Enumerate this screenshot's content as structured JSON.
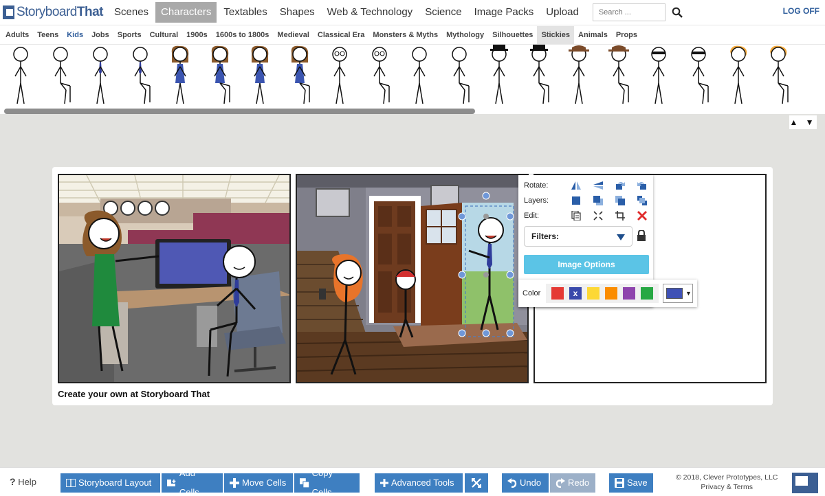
{
  "brand": {
    "name_light": "Storyboard",
    "name_bold": "That"
  },
  "topnav": {
    "items": [
      "Scenes",
      "Characters",
      "Textables",
      "Shapes",
      "Web & Technology",
      "Science",
      "Image Packs",
      "Upload"
    ],
    "active": "Characters",
    "search_placeholder": "Search ...",
    "logoff": "LOG OFF"
  },
  "categories": {
    "items": [
      "Adults",
      "Teens",
      "Kids",
      "Jobs",
      "Sports",
      "Cultural",
      "1900s",
      "1600s to 1800s",
      "Medieval",
      "Classical Era",
      "Monsters & Myths",
      "Mythology",
      "Silhouettes",
      "Stickies",
      "Animals",
      "Props"
    ],
    "selected": "Stickies",
    "highlighted": "Kids"
  },
  "character_strip": {
    "scroll_arrows": "▲ ▼",
    "characters": [
      {
        "hair": "none",
        "pose": "stand",
        "tie": false
      },
      {
        "hair": "none",
        "pose": "sit",
        "tie": false
      },
      {
        "hair": "none",
        "pose": "stand",
        "tie": true
      },
      {
        "hair": "none",
        "pose": "sit",
        "tie": true
      },
      {
        "hair": "brown",
        "pose": "stand",
        "dress": true
      },
      {
        "hair": "brown",
        "pose": "sit",
        "dress": true
      },
      {
        "hair": "brown",
        "pose": "stand",
        "dress": true
      },
      {
        "hair": "brown",
        "pose": "sit",
        "dress": true
      },
      {
        "hair": "glasses",
        "pose": "stand"
      },
      {
        "hair": "glasses",
        "pose": "sit"
      },
      {
        "hair": "none",
        "pose": "stand"
      },
      {
        "hair": "none",
        "pose": "sit"
      },
      {
        "hair": "tophat",
        "pose": "stand"
      },
      {
        "hair": "tophat",
        "pose": "sit"
      },
      {
        "hair": "fedora",
        "pose": "stand"
      },
      {
        "hair": "fedora",
        "pose": "sit"
      },
      {
        "hair": "mask",
        "pose": "stand"
      },
      {
        "hair": "mask",
        "pose": "sit"
      },
      {
        "hair": "blonde",
        "pose": "stand"
      },
      {
        "hair": "blonde",
        "pose": "sit"
      }
    ]
  },
  "storyboard": {
    "caption": "Create your own at Storyboard That"
  },
  "popup": {
    "rotate_label": "Rotate:",
    "layers_label": "Layers:",
    "edit_label": "Edit:",
    "filters_label": "Filters:",
    "image_options": "Image Options",
    "color_label": "Color",
    "color_swatches": [
      "#e53935",
      "#3949ab",
      "#fdd835",
      "#fb8c00",
      "#8e44ad",
      "#27a844"
    ],
    "swatch_x": "x",
    "current_color": "#3f51b5"
  },
  "toolbar": {
    "help": "Help",
    "help_icon": "?",
    "storyboard_layout": "Storyboard Layout",
    "add_cells": "Add Cells",
    "move_cells": "Move Cells",
    "copy_cells": "Copy Cells",
    "advanced_tools": "Advanced Tools",
    "undo": "Undo",
    "redo": "Redo",
    "save": "Save",
    "copyright": "© 2018, Clever Prototypes, LLC",
    "privacy": "Privacy & Terms"
  }
}
